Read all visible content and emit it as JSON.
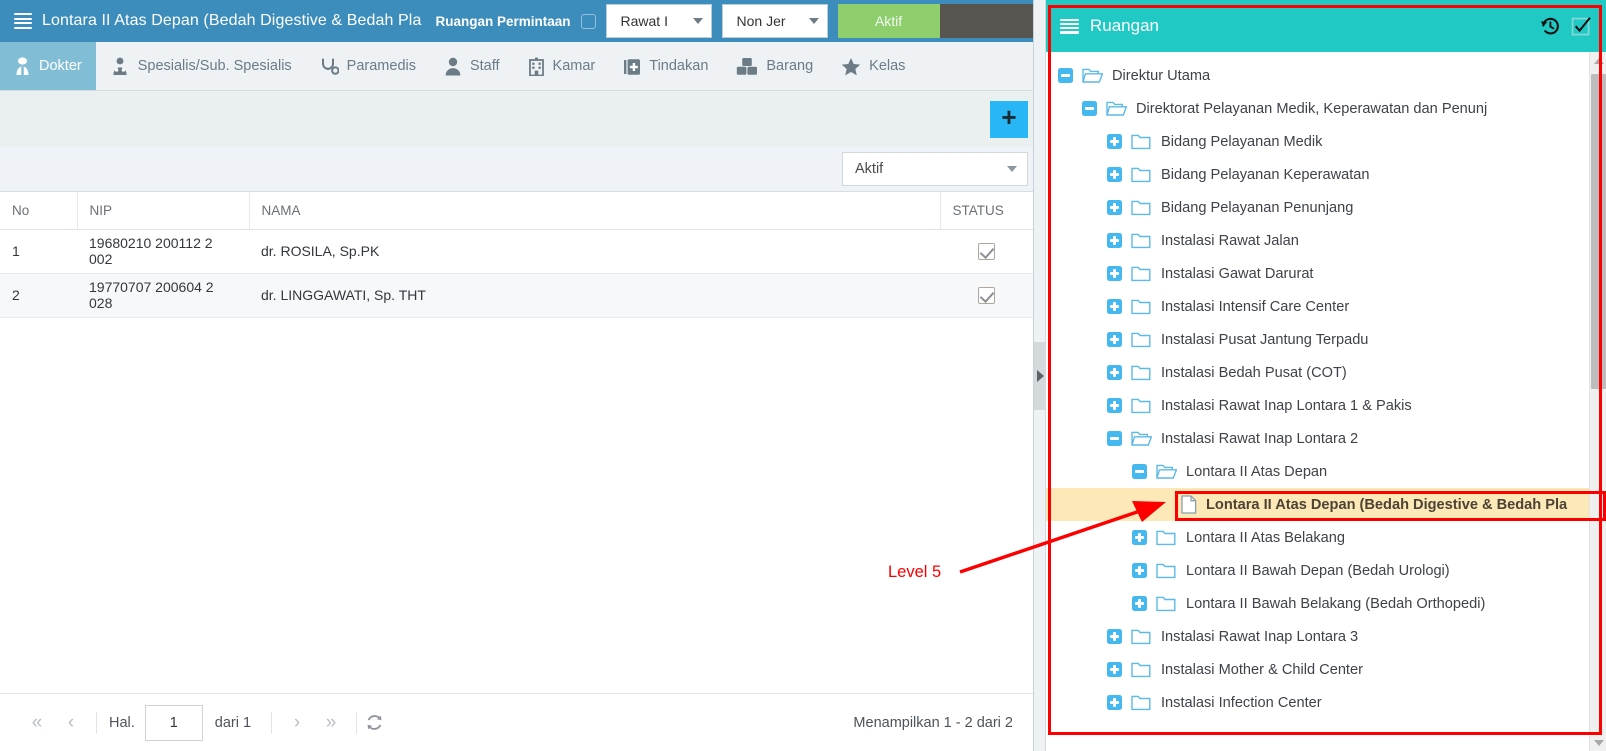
{
  "header": {
    "menu_icon": "hamburger-icon",
    "title": "Lontara II Atas Depan (Bedah Digestive & Bedah Pla",
    "subtitle": "Ruangan Permintaan",
    "checkbox_checked": false,
    "select_care": "Rawat I",
    "select_class": "Non Jer",
    "btn_active": "Aktif"
  },
  "tabs": [
    {
      "label": "Dokter",
      "icon": "doctor-icon",
      "active": true
    },
    {
      "label": "Spesialis/Sub. Spesialis",
      "icon": "specialist-icon",
      "active": false
    },
    {
      "label": "Paramedis",
      "icon": "stethoscope-icon",
      "active": false
    },
    {
      "label": "Staff",
      "icon": "user-icon",
      "active": false
    },
    {
      "label": "Kamar",
      "icon": "building-icon",
      "active": false
    },
    {
      "label": "Tindakan",
      "icon": "medkit-icon",
      "active": false
    },
    {
      "label": "Barang",
      "icon": "boxes-icon",
      "active": false
    },
    {
      "label": "Kelas",
      "icon": "star-icon",
      "active": false
    }
  ],
  "toolbar": {
    "add_label": "+",
    "add_icon": "plus-icon"
  },
  "filter": {
    "status_value": "Aktif",
    "caret_icon": "chevron-down-icon"
  },
  "table": {
    "columns": [
      "No",
      "NIP",
      "NAMA",
      "STATUS"
    ],
    "rows": [
      {
        "no": "1",
        "nip": "19680210 200112 2 002",
        "nama": "dr. ROSILA, Sp.PK",
        "status": true
      },
      {
        "no": "2",
        "nip": "19770707 200604 2 028",
        "nama": "dr. LINGGAWATI, Sp. THT",
        "status": true
      }
    ]
  },
  "pager": {
    "first_icon": "double-chevron-left-icon",
    "prev_icon": "chevron-left-icon",
    "page_label": "Hal.",
    "page_value": "1",
    "of_label": "dari 1",
    "next_icon": "chevron-right-icon",
    "last_icon": "double-chevron-right-icon",
    "refresh_icon": "refresh-icon",
    "summary": "Menampilkan 1 - 2 dari 2"
  },
  "tree_panel": {
    "menu_icon": "hamburger-icon",
    "title": "Ruangan",
    "history_icon": "history-icon",
    "check_icon": "checkbox-check-icon"
  },
  "tree": [
    {
      "label": "Direktur Utama",
      "level": 0,
      "state": "minus",
      "icon": "folder-open-icon"
    },
    {
      "label": "Direktorat Pelayanan Medik, Keperawatan dan Penunj",
      "level": 1,
      "state": "minus",
      "icon": "folder-open-icon"
    },
    {
      "label": "Bidang Pelayanan Medik",
      "level": 2,
      "state": "plus",
      "icon": "folder-icon"
    },
    {
      "label": "Bidang Pelayanan Keperawatan",
      "level": 2,
      "state": "plus",
      "icon": "folder-icon"
    },
    {
      "label": "Bidang Pelayanan Penunjang",
      "level": 2,
      "state": "plus",
      "icon": "folder-icon"
    },
    {
      "label": "Instalasi Rawat Jalan",
      "level": 2,
      "state": "plus",
      "icon": "folder-icon"
    },
    {
      "label": "Instalasi Gawat Darurat",
      "level": 2,
      "state": "plus",
      "icon": "folder-icon"
    },
    {
      "label": "Instalasi Intensif Care Center",
      "level": 2,
      "state": "plus",
      "icon": "folder-icon"
    },
    {
      "label": "Instalasi Pusat Jantung Terpadu",
      "level": 2,
      "state": "plus",
      "icon": "folder-icon"
    },
    {
      "label": "Instalasi Bedah Pusat (COT)",
      "level": 2,
      "state": "plus",
      "icon": "folder-icon"
    },
    {
      "label": "Instalasi Rawat Inap Lontara 1 & Pakis",
      "level": 2,
      "state": "plus",
      "icon": "folder-icon"
    },
    {
      "label": "Instalasi Rawat Inap Lontara 2",
      "level": 2,
      "state": "minus",
      "icon": "folder-open-icon"
    },
    {
      "label": "Lontara II Atas Depan",
      "level": 3,
      "state": "minus",
      "icon": "folder-open-icon"
    },
    {
      "label": "Lontara II Atas Depan (Bedah Digestive & Bedah Pla",
      "level": 4,
      "state": "leaf",
      "icon": "document-icon",
      "selected": true
    },
    {
      "label": "Lontara II Atas Belakang",
      "level": 3,
      "state": "plus",
      "icon": "folder-icon"
    },
    {
      "label": "Lontara II Bawah Depan (Bedah Urologi)",
      "level": 3,
      "state": "plus",
      "icon": "folder-icon"
    },
    {
      "label": "Lontara II Bawah Belakang (Bedah Orthopedi)",
      "level": 3,
      "state": "plus",
      "icon": "folder-icon"
    },
    {
      "label": "Instalasi Rawat Inap Lontara 3",
      "level": 2,
      "state": "plus",
      "icon": "folder-icon"
    },
    {
      "label": "Instalasi Mother & Child Center",
      "level": 2,
      "state": "plus",
      "icon": "folder-icon"
    },
    {
      "label": "Instalasi Infection Center",
      "level": 2,
      "state": "plus",
      "icon": "folder-icon"
    }
  ],
  "annotation": {
    "label": "Level 5",
    "color": "#fc0000"
  }
}
